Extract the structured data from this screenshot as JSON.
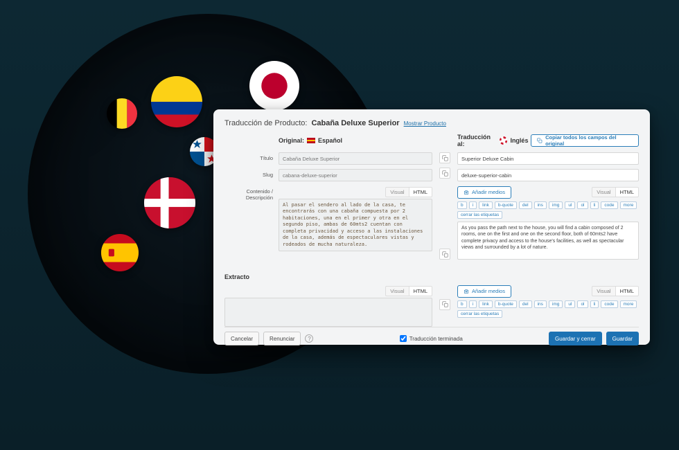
{
  "header": {
    "prefix": "Traducción de Producto:",
    "product_name": "Cabaña Deluxe Superior",
    "show_link": "Mostrar Producto"
  },
  "columns": {
    "original": {
      "label": "Original:",
      "lang": "Español"
    },
    "translation": {
      "label": "Traducción al:",
      "lang": "Inglés"
    }
  },
  "copy_all": "Copiar todos los campos del original",
  "fields": {
    "title_label": "Título",
    "slug_label": "Slug",
    "content_label": "Contenido / Descripción",
    "excerpt_label": "Extracto"
  },
  "original": {
    "title": "Cabaña Deluxe Superior",
    "slug": "cabana-deluxe-superior",
    "content": "Al pasar el sendero al lado de la casa, te encontrarás con una cabaña compuesta por 2 habitaciones, una en el primer y otra en el segundo piso, ambas de 60mts2 cuentan con completa privacidad y acceso a las instalaciones de la casa, además de espectaculares vistas y rodeados de mucha naturaleza."
  },
  "translation": {
    "title": "Superior Deluxe Cabin",
    "slug": "deluxe-superior-cabin",
    "content": "As you pass the path next to the house, you will find a cabin composed of 2 rooms, one on the first and one on the second floor, both of 60mts2 have complete privacy and access to the house's facilities, as well as spectacular views and surrounded by a lot of nature."
  },
  "editor": {
    "add_media": "Añadir medios",
    "tab_visual": "Visual",
    "tab_html": "HTML",
    "tags": [
      "b",
      "i",
      "link",
      "b-quote",
      "del",
      "ins",
      "img",
      "ul",
      "ol",
      "li",
      "code",
      "more"
    ],
    "close_tags": "cerrar las etiquetas"
  },
  "footer": {
    "cancel": "Cancelar",
    "renounce": "Renunciar",
    "finished": "Traducción terminada",
    "save_close": "Guardar y cerrar",
    "save": "Guardar"
  }
}
